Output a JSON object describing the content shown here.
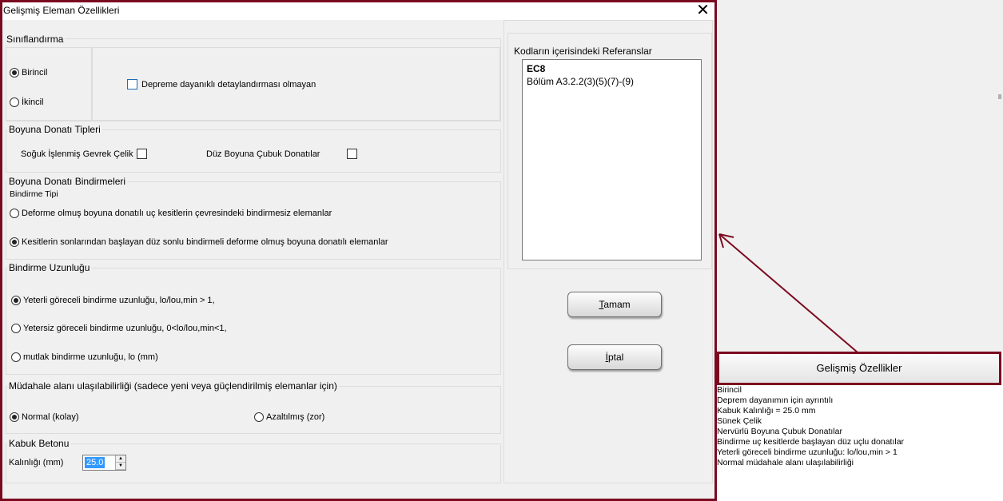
{
  "dialog": {
    "title": "Gelişmiş Eleman Özellikleri",
    "close_glyph": "✕",
    "classification": {
      "title": "Sınıflandırma",
      "options": [
        "Birincil",
        "İkincil"
      ],
      "selected": "Birincil",
      "checkbox_label": "Depreme dayanıklı detaylandırması olmayan",
      "checkbox_checked": false
    },
    "rebar_types": {
      "title": "Boyuna Donatı Tipleri",
      "cold_worked_label": "Soğuk İşlenmiş Gevrek Çelik",
      "cold_worked_checked": false,
      "plain_bars_label": "Düz Boyuna Çubuk Donatılar",
      "plain_bars_checked": false
    },
    "lap_splices": {
      "title": "Boyuna Donatı Bindirmeleri",
      "subtitle": "Bindirme Tipi",
      "option1": "Deforme olmuş boyuna donatılı uç kesitlerin çevresindeki bindirmesiz elemanlar",
      "option2": "Kesitlerin sonlarından başlayan düz sonlu bindirmeli deforme olmuş boyuna donatılı elemanlar",
      "selected": "option2"
    },
    "lap_length": {
      "title": "Bindirme Uzunluğu",
      "option1": "Yeterli göreceli bindirme uzunluğu,  lo/lou,min > 1,",
      "option2": "Yetersiz göreceli bindirme uzunluğu,  0<lo/lou,min<1,",
      "option3": "mutlak bindirme uzunluğu, lo (mm)",
      "selected": "option1"
    },
    "accessibility": {
      "title": "Müdahale alanı ulaşılabilirliği (sadece yeni veya güçlendirilmiş elemanlar için)",
      "option_normal": "Normal (kolay)",
      "option_reduced": "Azaltılmış (zor)",
      "selected": "normal"
    },
    "cover": {
      "title": "Kabuk Betonu",
      "thickness_label": "Kalınlığı (mm)",
      "thickness_value": "25.0"
    },
    "references": {
      "title": "Kodların içerisindeki Referanslar",
      "code": "EC8",
      "section": "Bölüm A3.2.2(3)(5)(7)-(9)"
    },
    "ok_prefix": "",
    "ok_mnemonic": "T",
    "ok_rest": "amam",
    "cancel_mnemonic": "İ",
    "cancel_rest": "ptal"
  },
  "side_panel": {
    "button_label": "Gelişmiş Özellikler",
    "summary_lines": [
      "Birincil",
      "Deprem dayanımın için ayrıntılı",
      "Kabuk Kalınlığı = 25.0 mm",
      "Sünek Çelik",
      "Nervürlü Boyuna Çubuk Donatılar",
      "Bindirme uç kesitlerde başlayan düz uçlu donatılar",
      "Yeterli göreceli bindirme uzunluğu: lo/lou,min > 1",
      "Normal müdahale alanı ulaşılabilirliği"
    ]
  },
  "colors": {
    "highlight_border": "#7b0a20",
    "selection_blue": "#3399ff"
  }
}
